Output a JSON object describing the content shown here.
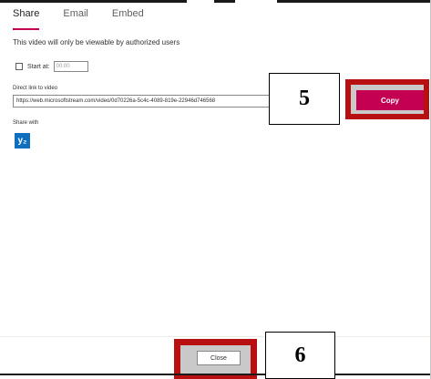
{
  "tabs": [
    {
      "label": "Share",
      "active": true
    },
    {
      "label": "Email",
      "active": false
    },
    {
      "label": "Embed",
      "active": false
    }
  ],
  "notice": "This video will only be viewable by authorized users",
  "start_at": {
    "label": "Start at:",
    "placeholder": "00:00"
  },
  "direct_link": {
    "label": "Direct link to video",
    "value": "https://web.microsoftstream.com/video/0d70226a-5c4c-4089-819e-22946d746568"
  },
  "share_with": {
    "label": "Share with",
    "icon": "yammer-icon",
    "glyph": "y₂"
  },
  "copy_button": {
    "label": "Copy"
  },
  "close_button": {
    "label": "Close"
  },
  "annotations": {
    "step5": "5",
    "step6": "6"
  },
  "colors": {
    "accent": "#c30052",
    "highlight_frame": "#b81010",
    "yammer": "#106ebe"
  }
}
